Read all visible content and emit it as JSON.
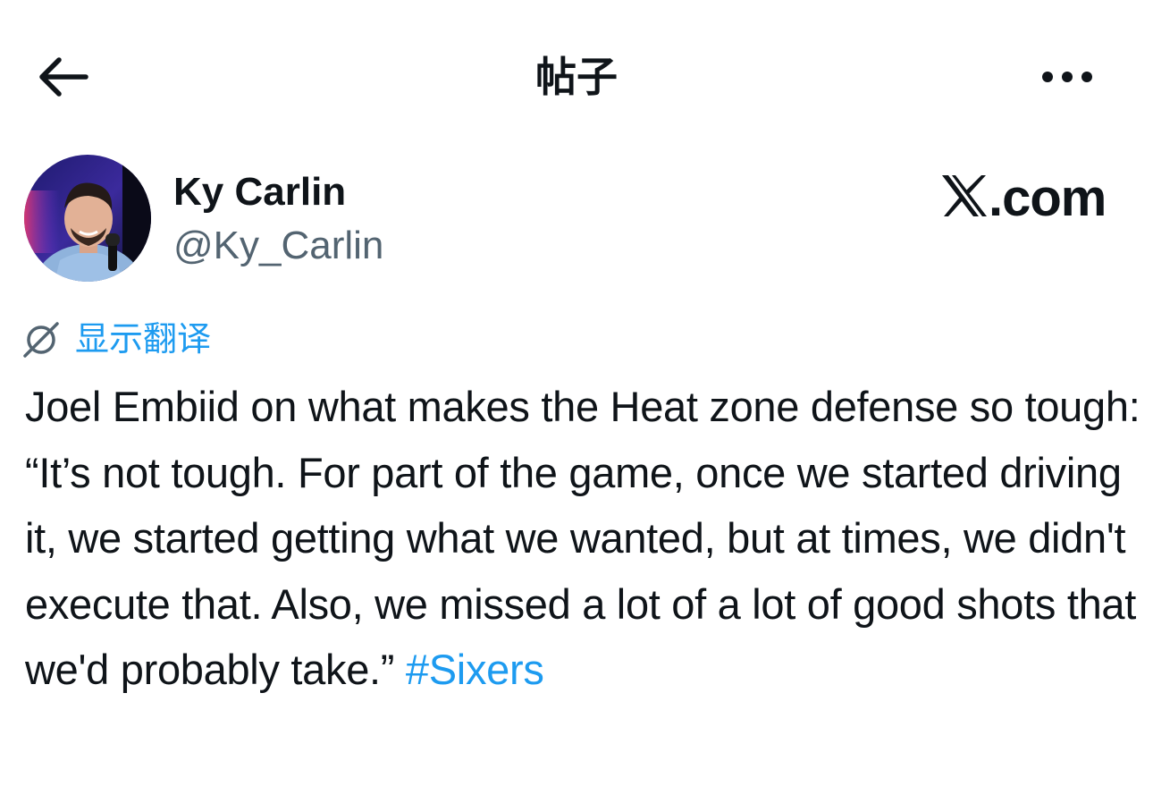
{
  "header": {
    "title": "帖子",
    "back_icon": "arrow-left-icon",
    "more_icon": "more-horizontal-icon"
  },
  "author": {
    "name": "Ky Carlin",
    "handle": "@Ky_Carlin",
    "avatar_icon": "avatar-photo"
  },
  "brand": {
    "text": ".com",
    "icon": "x-logo-icon"
  },
  "translate": {
    "label": "显示翻译",
    "icon": "translate-globe-icon"
  },
  "post": {
    "text": "Joel Embiid on what makes the Heat zone defense so tough: “It’s not tough. For part of the game, once we started driving it, we started getting what we wanted, but at times, we didn't execute that. Also, we missed a lot of a lot of good shots that we'd probably take.”",
    "hashtag": "#Sixers"
  },
  "colors": {
    "accent": "#1d9bf0",
    "text": "#0f1419",
    "secondary": "#536471",
    "background": "#ffffff"
  }
}
